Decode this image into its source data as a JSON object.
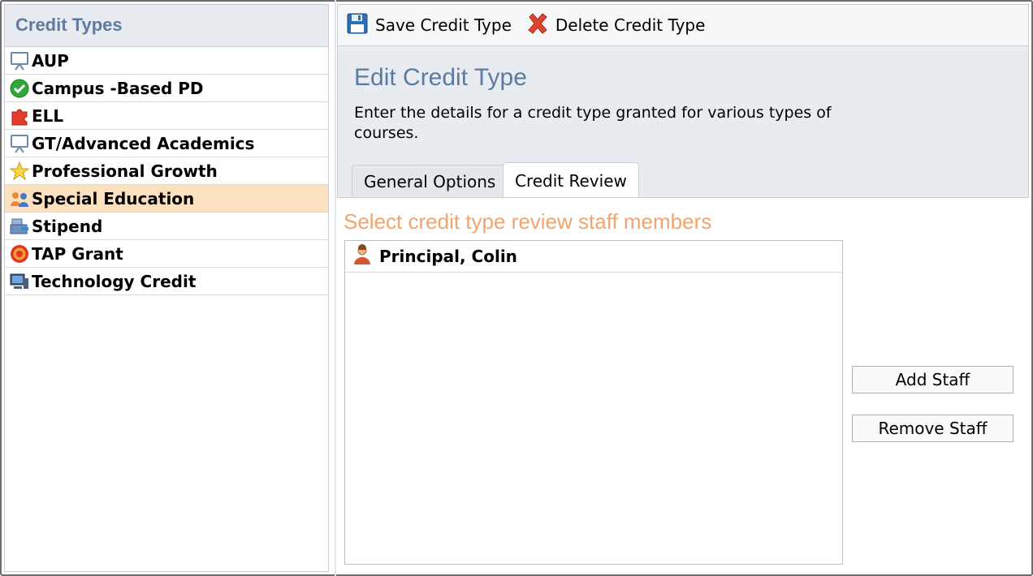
{
  "sidebar": {
    "title": "Credit Types",
    "items": [
      {
        "label": "AUP",
        "icon": "presentation-board-icon"
      },
      {
        "label": "Campus -Based PD",
        "icon": "green-check-icon"
      },
      {
        "label": "ELL",
        "icon": "puzzle-piece-icon"
      },
      {
        "label": "GT/Advanced Academics",
        "icon": "presentation-board-icon"
      },
      {
        "label": "Professional Growth",
        "icon": "star-icon"
      },
      {
        "label": "Special Education",
        "icon": "people-group-icon",
        "selected": true
      },
      {
        "label": "Stipend",
        "icon": "cash-register-icon"
      },
      {
        "label": "TAP Grant",
        "icon": "target-icon"
      },
      {
        "label": "Technology Credit",
        "icon": "computer-icon"
      }
    ]
  },
  "toolbar": {
    "save_label": "Save Credit Type",
    "delete_label": "Delete Credit Type"
  },
  "edit": {
    "title": "Edit Credit Type",
    "description": "Enter the details for a credit type granted for various types of courses."
  },
  "tabs": [
    {
      "label": "General Options",
      "active": false
    },
    {
      "label": "Credit Review",
      "active": true
    }
  ],
  "review": {
    "section_title": "Select credit type review staff members",
    "staff": [
      {
        "name": "Principal, Colin"
      }
    ],
    "add_label": "Add Staff",
    "remove_label": "Remove Staff"
  },
  "colors": {
    "header_blue": "#5d7b9e",
    "section_orange": "#f3a46c",
    "selected_row": "#fbe1c0",
    "panel_gray": "#e8ecf0"
  }
}
